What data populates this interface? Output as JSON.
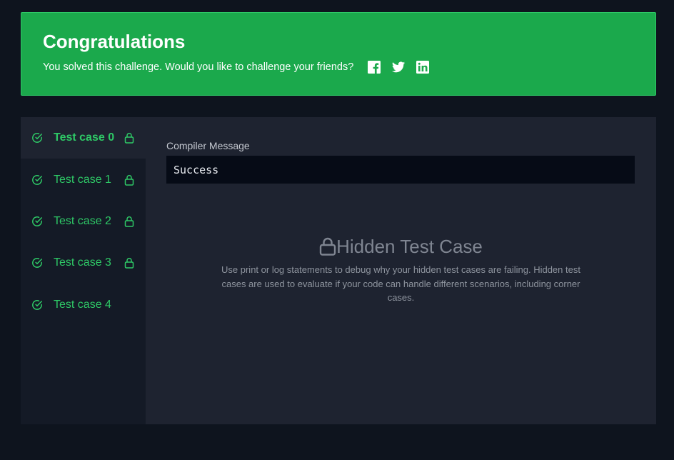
{
  "banner": {
    "title": "Congratulations",
    "message": "You solved this challenge. Would you like to challenge your friends?",
    "share_icons": [
      "facebook-icon",
      "twitter-icon",
      "linkedin-icon"
    ],
    "background_color": "#1ba94c"
  },
  "test_cases": [
    {
      "label": "Test case 0",
      "status": "passed",
      "locked": true,
      "active": true
    },
    {
      "label": "Test case 1",
      "status": "passed",
      "locked": true,
      "active": false
    },
    {
      "label": "Test case 2",
      "status": "passed",
      "locked": true,
      "active": false
    },
    {
      "label": "Test case 3",
      "status": "passed",
      "locked": true,
      "active": false
    },
    {
      "label": "Test case 4",
      "status": "passed",
      "locked": false,
      "active": false
    }
  ],
  "compiler": {
    "label": "Compiler Message",
    "message": "Success"
  },
  "hidden_case": {
    "title": "Hidden Test Case",
    "description": "Use print or log statements to debug why your hidden test cases are failing. Hidden test cases are used to evaluate if your code can handle different scenarios, including corner cases."
  },
  "colors": {
    "accent_green": "#2ec866",
    "page_bg": "#0e141e",
    "panel_bg": "#1e2330"
  }
}
